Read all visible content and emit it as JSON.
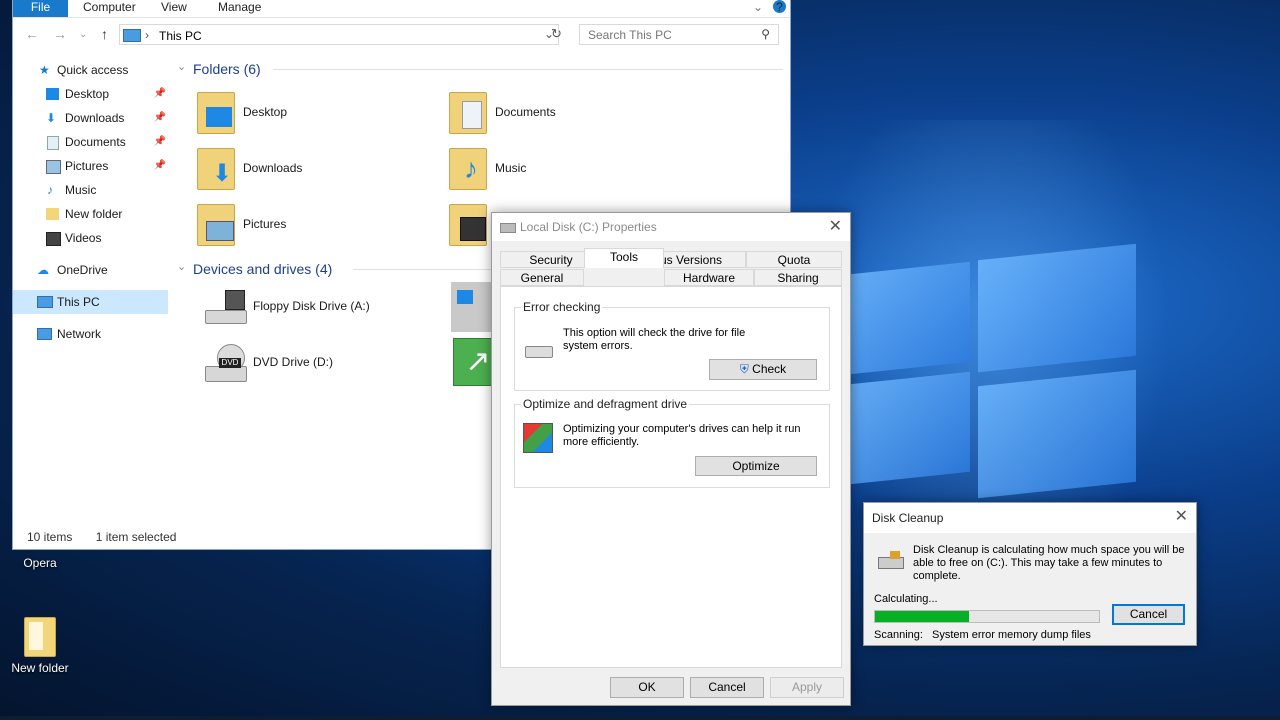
{
  "explorer": {
    "ribbon_tabs": [
      "File",
      "Computer",
      "View",
      "Manage"
    ],
    "help_label": "?",
    "address": "This PC",
    "search_placeholder": "Search This PC",
    "sidebar": [
      {
        "label": "Quick access"
      },
      {
        "label": "Desktop",
        "pinned": true
      },
      {
        "label": "Downloads",
        "pinned": true
      },
      {
        "label": "Documents",
        "pinned": true
      },
      {
        "label": "Pictures",
        "pinned": true
      },
      {
        "label": "Music"
      },
      {
        "label": "New folder"
      },
      {
        "label": "Videos"
      },
      {
        "label": "OneDrive"
      },
      {
        "label": "This PC",
        "selected": true
      },
      {
        "label": "Network"
      }
    ],
    "folders_header": "Folders (6)",
    "folders": [
      "Desktop",
      "Documents",
      "Downloads",
      "Music",
      "Pictures"
    ],
    "drives_header": "Devices and drives (4)",
    "drives": [
      "Floppy Disk Drive (A:)",
      "DVD Drive (D:)"
    ],
    "dvd_badge": "DVD",
    "status_items": "10 items",
    "status_selected": "1 item selected"
  },
  "desktop": {
    "icons": [
      "Opera",
      "New folder"
    ]
  },
  "properties": {
    "title": "Local Disk (C:) Properties",
    "tabs_row1": [
      "Security",
      "Previous Versions",
      "Quota"
    ],
    "tabs_row2": [
      "General",
      "Tools",
      "Hardware",
      "Sharing"
    ],
    "active_tab": "Tools",
    "error_checking": {
      "title": "Error checking",
      "text": "This option will check the drive for file system errors.",
      "button": "Check"
    },
    "optimize": {
      "title": "Optimize and defragment drive",
      "text": "Optimizing your computer's drives can help it run more efficiently.",
      "button": "Optimize"
    },
    "buttons": {
      "ok": "OK",
      "cancel": "Cancel",
      "apply": "Apply"
    }
  },
  "cleanup": {
    "title": "Disk Cleanup",
    "message": "Disk Cleanup is calculating how much space you will be able to free on  (C:). This may take a few minutes to complete.",
    "status": "Calculating...",
    "progress_fraction": 0.42,
    "cancel": "Cancel",
    "scanning_label": "Scanning:",
    "scanning_item": "System error memory dump files"
  },
  "colors": {
    "accent": "#1979ca",
    "progress": "#06b025",
    "group_header": "#1e3f8f"
  }
}
